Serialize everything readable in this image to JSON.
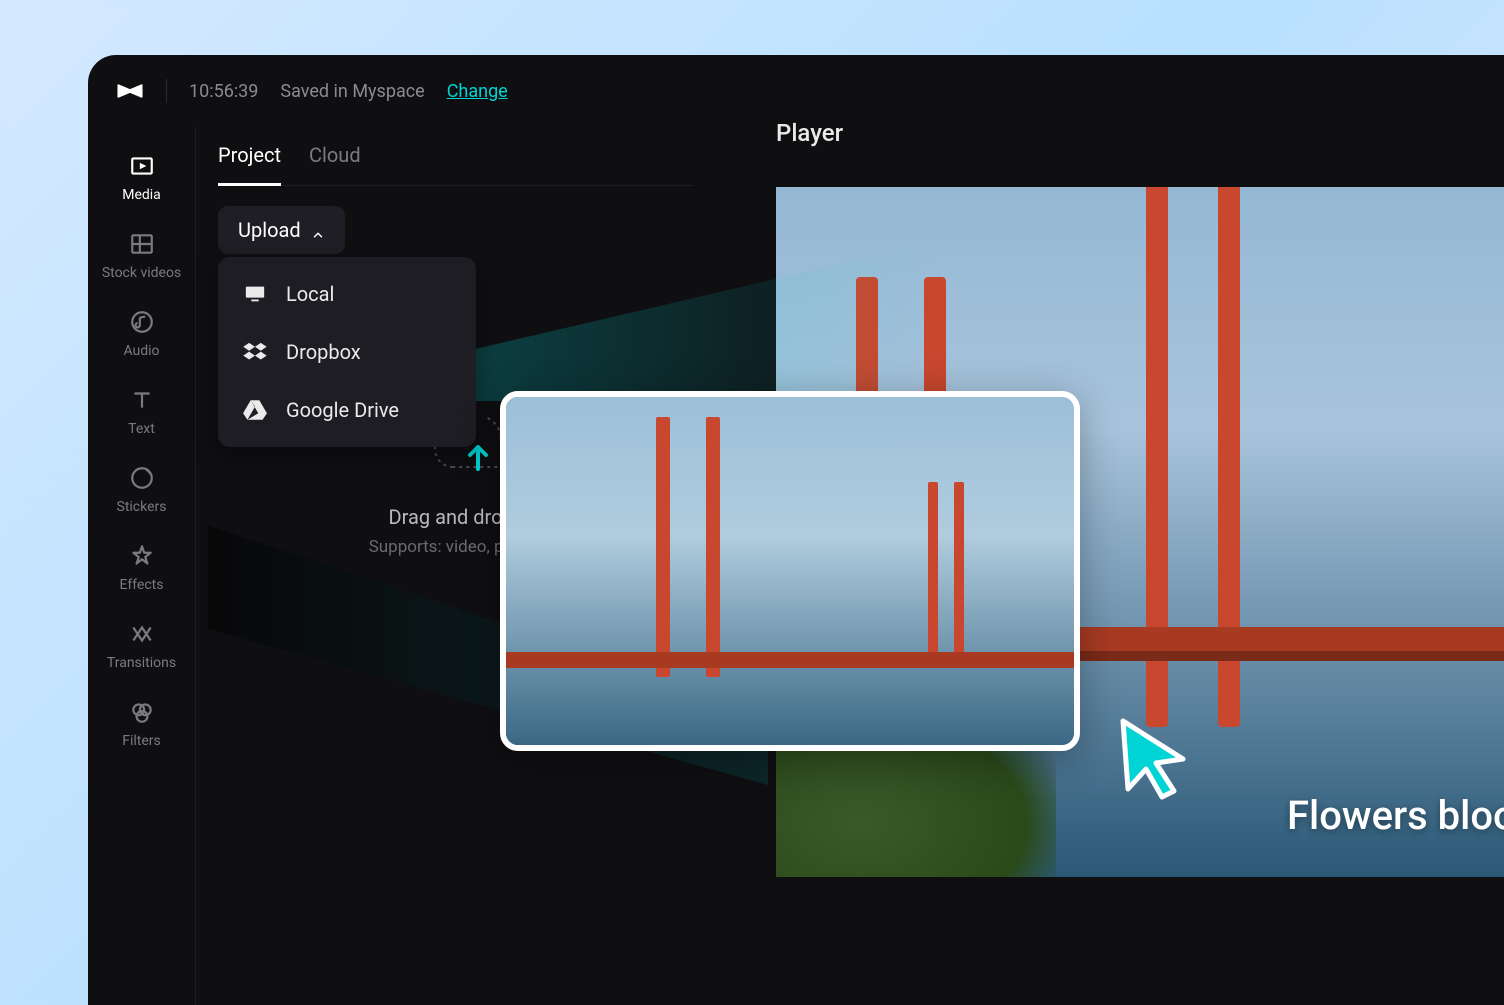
{
  "topbar": {
    "timestamp": "10:56:39",
    "save_status": "Saved in Myspace",
    "change_label": "Change"
  },
  "sidebar": {
    "items": [
      {
        "label": "Media"
      },
      {
        "label": "Stock videos"
      },
      {
        "label": "Audio"
      },
      {
        "label": "Text"
      },
      {
        "label": "Stickers"
      },
      {
        "label": "Effects"
      },
      {
        "label": "Transitions"
      },
      {
        "label": "Filters"
      }
    ]
  },
  "media_panel": {
    "tabs": [
      {
        "label": "Project"
      },
      {
        "label": "Cloud"
      }
    ],
    "upload_label": "Upload",
    "upload_menu": [
      {
        "label": "Local"
      },
      {
        "label": "Dropbox"
      },
      {
        "label": "Google Drive"
      }
    ],
    "drop_text": "Drag and drop files f",
    "drop_subtext": "Supports: video, photo, audio"
  },
  "player": {
    "title": "Player",
    "caption": "Flowers bloom in sp"
  }
}
